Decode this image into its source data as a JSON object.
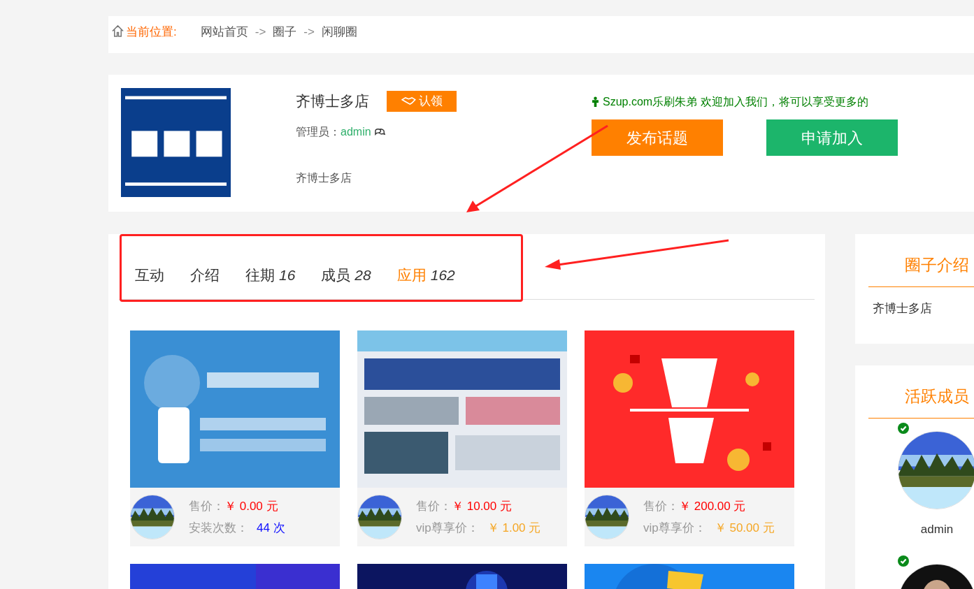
{
  "breadcrumb": {
    "label": "当前位置:",
    "items": [
      "网站首页",
      "圈子",
      "闲聊圈"
    ],
    "separator": "->"
  },
  "group": {
    "name": "齐博士多店",
    "claim_button": "认领",
    "admin_label": "管理员：",
    "admin_name": "admin",
    "description": "齐博士多店",
    "welcome": "Szup.com乐刷朱弟 欢迎加入我们，将可以享受更多的",
    "buttons": [
      {
        "label": "发布话题",
        "kind": "publish"
      },
      {
        "label": "申请加入",
        "kind": "join"
      }
    ]
  },
  "tabs": [
    {
      "label": "互动",
      "selected": false
    },
    {
      "label": "介绍",
      "selected": false
    },
    {
      "label": "往期",
      "count": "16",
      "selected": false
    },
    {
      "label": "成员",
      "count": "28",
      "selected": false
    },
    {
      "label": "应用",
      "count": "162",
      "selected": true
    }
  ],
  "apps": [
    {
      "kind": "picture",
      "price_label": "售价：",
      "price": "￥ 0.00 元",
      "second": {
        "kind": "installs",
        "label": "安装次数：",
        "value": "44 次"
      }
    },
    {
      "kind": "picture",
      "price_label": "售价：",
      "price": "￥ 10.00 元",
      "second": {
        "kind": "vip",
        "label": "vip尊享价：",
        "value": "￥ 1.00 元"
      }
    },
    {
      "kind": "picture",
      "price_label": "售价：",
      "price": "￥ 200.00 元",
      "second": {
        "kind": "vip",
        "label": "vip尊享价：",
        "value": "￥ 50.00 元"
      }
    },
    {
      "kind": "picture"
    },
    {
      "kind": "picture"
    },
    {
      "kind": "picture"
    }
  ],
  "sidebar": {
    "intro": {
      "title": "圈子介绍",
      "text": "齐博士多店"
    },
    "members": {
      "title": "活跃成员",
      "items": [
        {
          "name": "admin",
          "verified": true
        },
        {
          "verified": true
        }
      ]
    }
  }
}
